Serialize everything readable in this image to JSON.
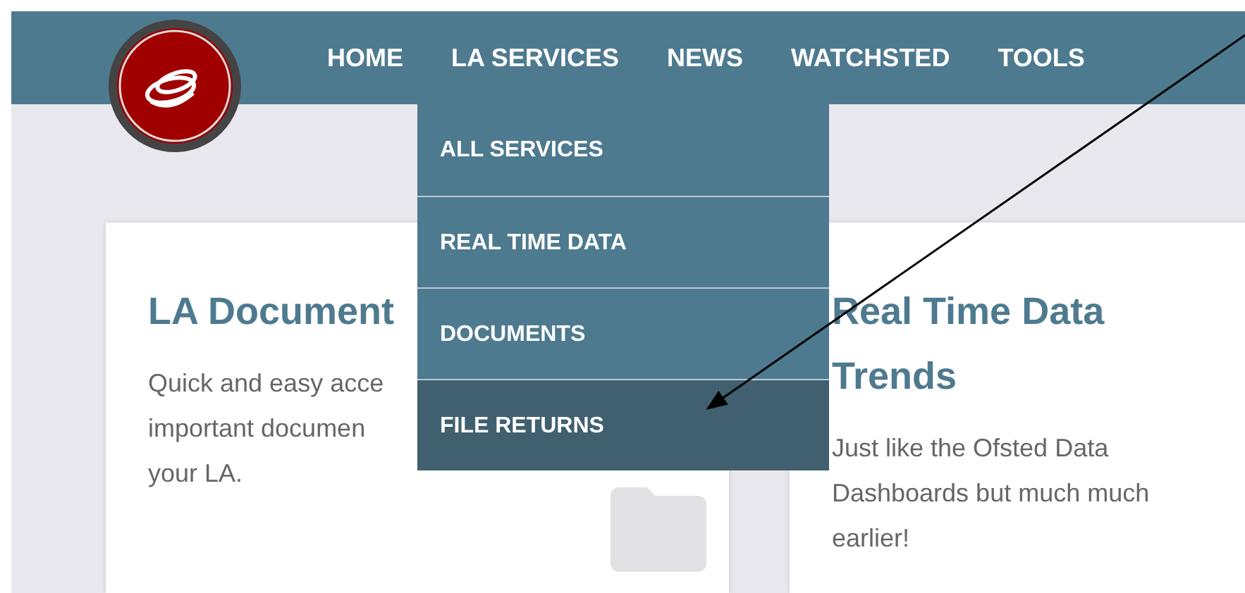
{
  "nav": {
    "items": [
      {
        "label": "HOME"
      },
      {
        "label": "LA SERVICES"
      },
      {
        "label": "NEWS"
      },
      {
        "label": "WATCHSTED"
      },
      {
        "label": "TOOLS"
      }
    ]
  },
  "dropdown": {
    "items": [
      {
        "label": "ALL SERVICES",
        "highlighted": false
      },
      {
        "label": "REAL TIME DATA",
        "highlighted": false
      },
      {
        "label": "DOCUMENTS",
        "highlighted": false
      },
      {
        "label": "FILE RETURNS",
        "highlighted": true
      }
    ]
  },
  "cards": [
    {
      "title": "LA Document",
      "lines": [
        "Quick and easy acce",
        "important documen",
        "your LA."
      ]
    },
    {
      "title": "Real Time Data Trends",
      "lines": [
        "Just like the Ofsted Data",
        "Dashboards but much much",
        "earlier!"
      ]
    }
  ]
}
